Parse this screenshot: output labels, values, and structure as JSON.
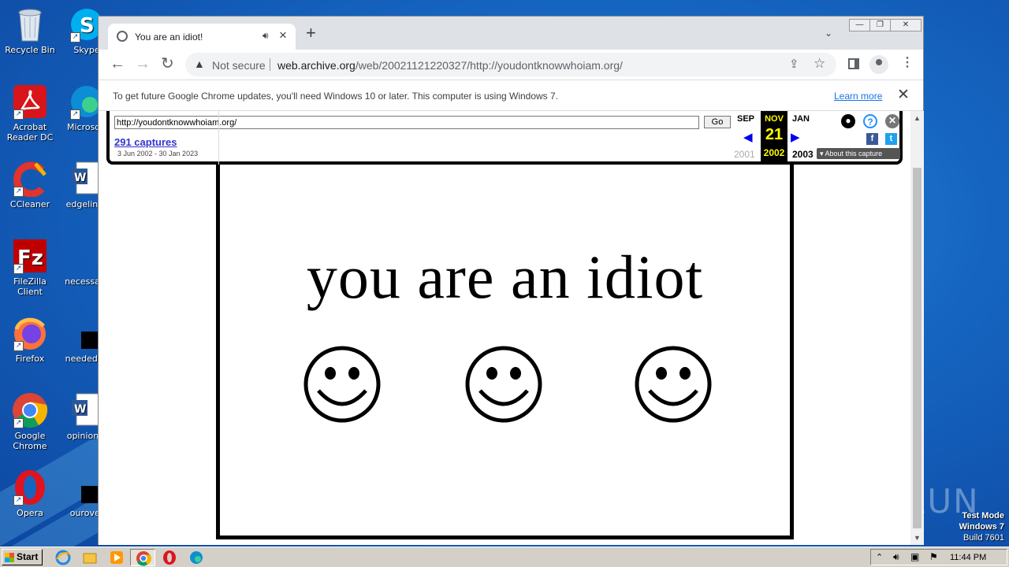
{
  "desktop": {
    "icons": [
      {
        "label": "Recycle Bin"
      },
      {
        "label": "Skype"
      },
      {
        "label": "Acrobat Reader DC"
      },
      {
        "label": "Microsoft"
      },
      {
        "label": "CCleaner"
      },
      {
        "label": "edgelinks"
      },
      {
        "label": "FileZilla Client"
      },
      {
        "label": "necessary"
      },
      {
        "label": "Firefox"
      },
      {
        "label": "neededny"
      },
      {
        "label": "Google Chrome"
      },
      {
        "label": "opiniongi"
      },
      {
        "label": "Opera"
      },
      {
        "label": "ourover"
      }
    ],
    "watermark": {
      "line1": "Test Mode",
      "line2": "Windows 7",
      "line3": "Build 7601"
    },
    "anyrun_logo": "ANY RUN"
  },
  "browser": {
    "tab": {
      "title": "You are an idiot!"
    },
    "address": {
      "security": "Not secure",
      "host": "web.archive.org",
      "path": "/web/20021121220327/http://youdontknowwhoiam.org/"
    },
    "infobar": {
      "message": "To get future Google Chrome updates, you'll need Windows 10 or later. This computer is using Windows 7.",
      "link": "Learn more"
    }
  },
  "wayback": {
    "url_value": "http://youdontknowwhoiam.org/",
    "go_label": "Go",
    "captures_link": "291 captures",
    "capture_range": "3 Jun 2002 - 30 Jan 2023",
    "prev": {
      "month": "SEP",
      "year": "2001"
    },
    "current": {
      "month": "NOV",
      "day": "21",
      "year": "2002"
    },
    "next": {
      "month": "JAN",
      "year": "2003"
    },
    "about_label": "About this capture"
  },
  "page": {
    "headline": "you are an idiot",
    "smiley_count": 3
  },
  "taskbar": {
    "start_label": "Start",
    "clock": "11:44 PM"
  }
}
